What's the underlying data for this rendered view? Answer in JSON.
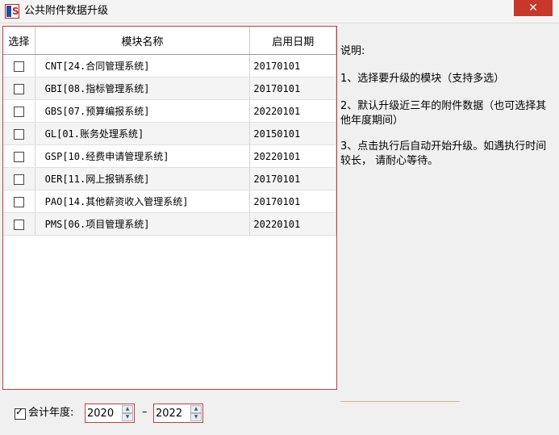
{
  "window": {
    "title": "公共附件数据升级",
    "close_glyph": "✕"
  },
  "grid": {
    "headers": [
      "选择",
      "模块名称",
      "启用日期"
    ],
    "rows": [
      {
        "name": "CNT[24.合同管理系统]",
        "date": "20170101"
      },
      {
        "name": "GBI[08.指标管理系统]",
        "date": "20170101"
      },
      {
        "name": "GBS[07.预算编报系统]",
        "date": "20220101"
      },
      {
        "name": "GL[01.账务处理系统]",
        "date": "20150101"
      },
      {
        "name": "GSP[10.经费申请管理系统]",
        "date": "20220101"
      },
      {
        "name": "OER[11.网上报销系统]",
        "date": "20170101"
      },
      {
        "name": "PAO[14.其他薪资收入管理系统]",
        "date": "20170101"
      },
      {
        "name": "PMS[06.项目管理系统]",
        "date": "20220101"
      }
    ]
  },
  "description": {
    "title": "说明:",
    "items": [
      "1、选择要升级的模块（支持多选）",
      "2、默认升级近三年的附件数据（也可选择其他年度期间）",
      "3、点击执行后自动开始升级。如遇执行时间较长， 请耐心等待。"
    ]
  },
  "fiscal_year": {
    "label": "会计年度:",
    "checked": true,
    "from": "2020",
    "to": "2022",
    "separator": "–"
  }
}
